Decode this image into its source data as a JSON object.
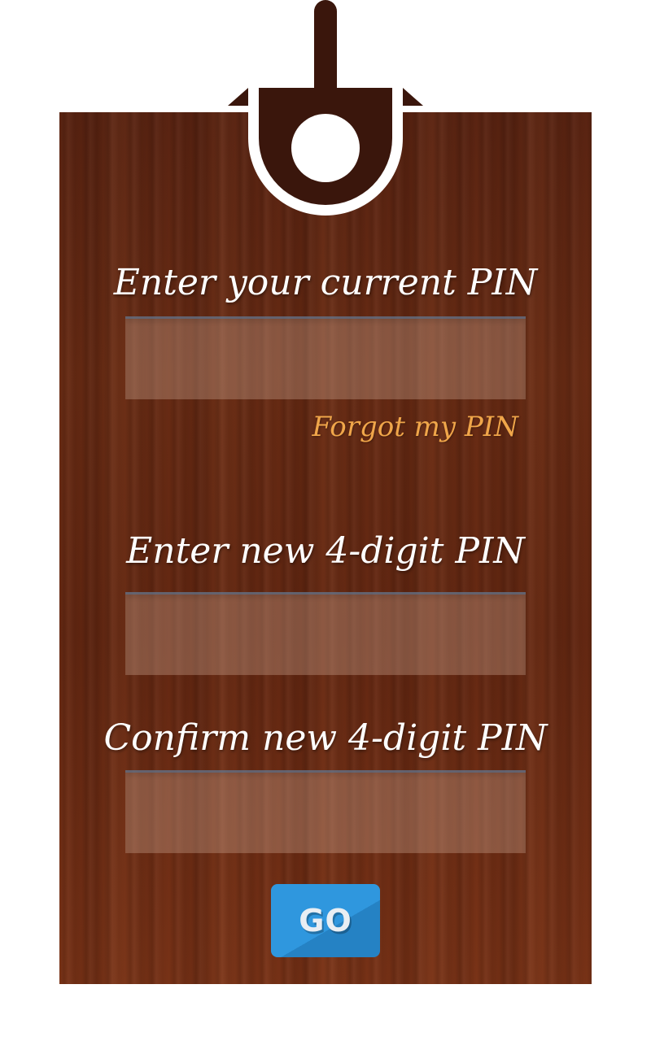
{
  "form": {
    "current_pin_label": "Enter your current PIN",
    "current_pin_value": "",
    "forgot_link": "Forgot my PIN",
    "new_pin_label": "Enter new 4-digit PIN",
    "new_pin_value": "",
    "confirm_pin_label": "Confirm new 4-digit PIN",
    "confirm_pin_value": "",
    "go_label": "GO"
  },
  "icons": {
    "hanger": "tag-hanger-icon"
  },
  "colors": {
    "wood": "#652812",
    "hanger": "#3a160c",
    "label_text": "#ffffff",
    "forgot_link": "#f0a64a",
    "go_button": "#2f97de"
  }
}
